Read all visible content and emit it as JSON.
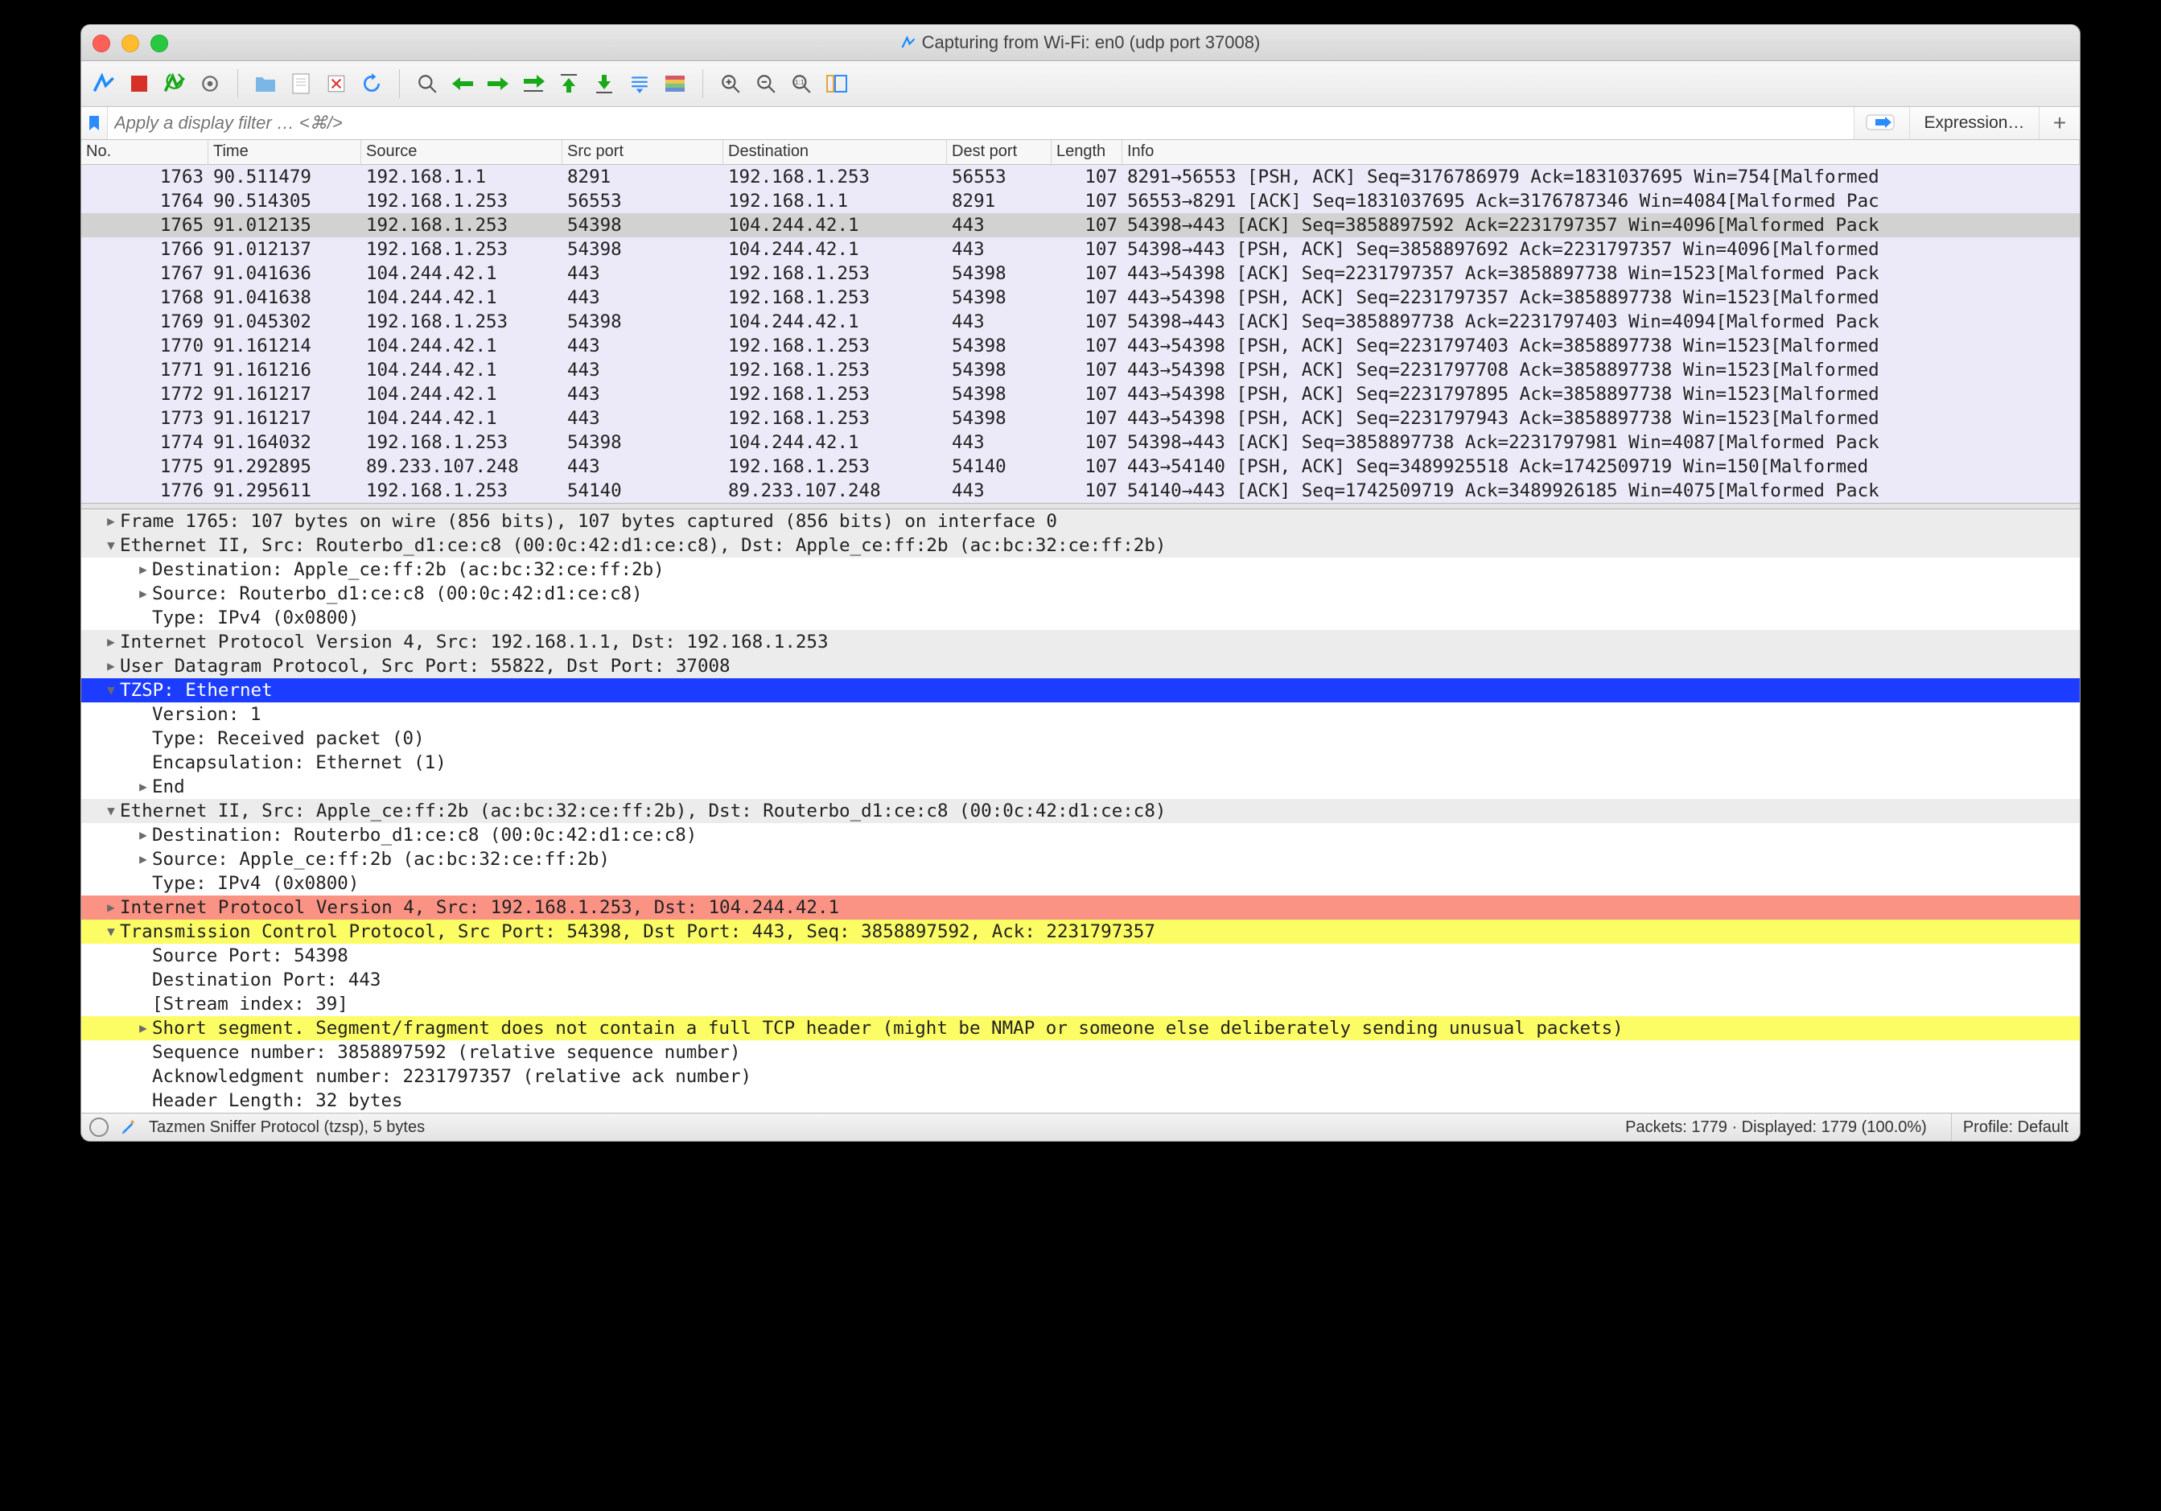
{
  "title": "Capturing from Wi-Fi: en0 (udp port 37008)",
  "filter": {
    "placeholder": "Apply a display filter … <⌘/>",
    "expression": "Expression…"
  },
  "columns": {
    "no": "No.",
    "time": "Time",
    "src": "Source",
    "sport": "Src port",
    "dst": "Destination",
    "dport": "Dest port",
    "len": "Length",
    "info": "Info"
  },
  "packets": [
    {
      "no": "1763",
      "time": "90.511479",
      "src": "192.168.1.1",
      "sport": "8291",
      "dst": "192.168.1.253",
      "dport": "56553",
      "len": "107",
      "info": "8291→56553 [PSH, ACK] Seq=3176786979 Ack=1831037695 Win=754[Malformed",
      "cls": "purple"
    },
    {
      "no": "1764",
      "time": "90.514305",
      "src": "192.168.1.253",
      "sport": "56553",
      "dst": "192.168.1.1",
      "dport": "8291",
      "len": "107",
      "info": "56553→8291 [ACK] Seq=1831037695 Ack=3176787346 Win=4084[Malformed Pac",
      "cls": "purple"
    },
    {
      "no": "1765",
      "time": "91.012135",
      "src": "192.168.1.253",
      "sport": "54398",
      "dst": "104.244.42.1",
      "dport": "443",
      "len": "107",
      "info": "54398→443 [ACK] Seq=3858897592 Ack=2231797357 Win=4096[Malformed Pack",
      "cls": "selected"
    },
    {
      "no": "1766",
      "time": "91.012137",
      "src": "192.168.1.253",
      "sport": "54398",
      "dst": "104.244.42.1",
      "dport": "443",
      "len": "107",
      "info": "54398→443 [PSH, ACK] Seq=3858897692 Ack=2231797357 Win=4096[Malformed",
      "cls": "purple"
    },
    {
      "no": "1767",
      "time": "91.041636",
      "src": "104.244.42.1",
      "sport": "443",
      "dst": "192.168.1.253",
      "dport": "54398",
      "len": "107",
      "info": "443→54398 [ACK] Seq=2231797357 Ack=3858897738 Win=1523[Malformed Pack",
      "cls": "purple"
    },
    {
      "no": "1768",
      "time": "91.041638",
      "src": "104.244.42.1",
      "sport": "443",
      "dst": "192.168.1.253",
      "dport": "54398",
      "len": "107",
      "info": "443→54398 [PSH, ACK] Seq=2231797357 Ack=3858897738 Win=1523[Malformed",
      "cls": "purple"
    },
    {
      "no": "1769",
      "time": "91.045302",
      "src": "192.168.1.253",
      "sport": "54398",
      "dst": "104.244.42.1",
      "dport": "443",
      "len": "107",
      "info": "54398→443 [ACK] Seq=3858897738 Ack=2231797403 Win=4094[Malformed Pack",
      "cls": "purple"
    },
    {
      "no": "1770",
      "time": "91.161214",
      "src": "104.244.42.1",
      "sport": "443",
      "dst": "192.168.1.253",
      "dport": "54398",
      "len": "107",
      "info": "443→54398 [PSH, ACK] Seq=2231797403 Ack=3858897738 Win=1523[Malformed",
      "cls": "purple"
    },
    {
      "no": "1771",
      "time": "91.161216",
      "src": "104.244.42.1",
      "sport": "443",
      "dst": "192.168.1.253",
      "dport": "54398",
      "len": "107",
      "info": "443→54398 [PSH, ACK] Seq=2231797708 Ack=3858897738 Win=1523[Malformed",
      "cls": "purple"
    },
    {
      "no": "1772",
      "time": "91.161217",
      "src": "104.244.42.1",
      "sport": "443",
      "dst": "192.168.1.253",
      "dport": "54398",
      "len": "107",
      "info": "443→54398 [PSH, ACK] Seq=2231797895 Ack=3858897738 Win=1523[Malformed",
      "cls": "purple"
    },
    {
      "no": "1773",
      "time": "91.161217",
      "src": "104.244.42.1",
      "sport": "443",
      "dst": "192.168.1.253",
      "dport": "54398",
      "len": "107",
      "info": "443→54398 [PSH, ACK] Seq=2231797943 Ack=3858897738 Win=1523[Malformed",
      "cls": "purple"
    },
    {
      "no": "1774",
      "time": "91.164032",
      "src": "192.168.1.253",
      "sport": "54398",
      "dst": "104.244.42.1",
      "dport": "443",
      "len": "107",
      "info": "54398→443 [ACK] Seq=3858897738 Ack=2231797981 Win=4087[Malformed Pack",
      "cls": "purple"
    },
    {
      "no": "1775",
      "time": "91.292895",
      "src": "89.233.107.248",
      "sport": "443",
      "dst": "192.168.1.253",
      "dport": "54140",
      "len": "107",
      "info": "443→54140 [PSH, ACK] Seq=3489925518 Ack=1742509719 Win=150[Malformed",
      "cls": "purple"
    },
    {
      "no": "1776",
      "time": "91.295611",
      "src": "192.168.1.253",
      "sport": "54140",
      "dst": "89.233.107.248",
      "dport": "443",
      "len": "107",
      "info": "54140→443 [ACK] Seq=1742509719 Ack=3489926185 Win=4075[Malformed Pack",
      "cls": "purple"
    }
  ],
  "tree": [
    {
      "ind": 0,
      "tri": "closed",
      "txt": "Frame 1765: 107 bytes on wire (856 bits), 107 bytes captured (856 bits) on interface 0",
      "bg": "grey"
    },
    {
      "ind": 0,
      "tri": "open",
      "txt": "Ethernet II, Src: Routerbo_d1:ce:c8 (00:0c:42:d1:ce:c8), Dst: Apple_ce:ff:2b (ac:bc:32:ce:ff:2b)",
      "bg": "grey"
    },
    {
      "ind": 1,
      "tri": "closed",
      "txt": "Destination: Apple_ce:ff:2b (ac:bc:32:ce:ff:2b)"
    },
    {
      "ind": 1,
      "tri": "closed",
      "txt": "Source: Routerbo_d1:ce:c8 (00:0c:42:d1:ce:c8)"
    },
    {
      "ind": 1,
      "tri": "",
      "txt": "Type: IPv4 (0x0800)"
    },
    {
      "ind": 0,
      "tri": "closed",
      "txt": "Internet Protocol Version 4, Src: 192.168.1.1, Dst: 192.168.1.253",
      "bg": "grey"
    },
    {
      "ind": 0,
      "tri": "closed",
      "txt": "User Datagram Protocol, Src Port: 55822, Dst Port: 37008",
      "bg": "grey"
    },
    {
      "ind": 0,
      "tri": "open",
      "txt": "TZSP: Ethernet",
      "bg": "blue"
    },
    {
      "ind": 1,
      "tri": "",
      "txt": "Version: 1"
    },
    {
      "ind": 1,
      "tri": "",
      "txt": "Type: Received packet (0)"
    },
    {
      "ind": 1,
      "tri": "",
      "txt": "Encapsulation: Ethernet (1)"
    },
    {
      "ind": 1,
      "tri": "closed",
      "txt": "End"
    },
    {
      "ind": 0,
      "tri": "open",
      "txt": "Ethernet II, Src: Apple_ce:ff:2b (ac:bc:32:ce:ff:2b), Dst: Routerbo_d1:ce:c8 (00:0c:42:d1:ce:c8)",
      "bg": "grey"
    },
    {
      "ind": 1,
      "tri": "closed",
      "txt": "Destination: Routerbo_d1:ce:c8 (00:0c:42:d1:ce:c8)"
    },
    {
      "ind": 1,
      "tri": "closed",
      "txt": "Source: Apple_ce:ff:2b (ac:bc:32:ce:ff:2b)"
    },
    {
      "ind": 1,
      "tri": "",
      "txt": "Type: IPv4 (0x0800)"
    },
    {
      "ind": 0,
      "tri": "closed",
      "txt": "Internet Protocol Version 4, Src: 192.168.1.253, Dst: 104.244.42.1",
      "bg": "red"
    },
    {
      "ind": 0,
      "tri": "open",
      "txt": "Transmission Control Protocol, Src Port: 54398, Dst Port: 443, Seq: 3858897592, Ack: 2231797357",
      "bg": "yellow"
    },
    {
      "ind": 1,
      "tri": "",
      "txt": "Source Port: 54398"
    },
    {
      "ind": 1,
      "tri": "",
      "txt": "Destination Port: 443"
    },
    {
      "ind": 1,
      "tri": "",
      "txt": "[Stream index: 39]"
    },
    {
      "ind": 1,
      "tri": "closed",
      "txt": "Short segment. Segment/fragment does not contain a full TCP header (might be NMAP or someone else deliberately sending unusual packets)",
      "bg": "yellow"
    },
    {
      "ind": 1,
      "tri": "",
      "txt": "Sequence number: 3858897592    (relative sequence number)"
    },
    {
      "ind": 1,
      "tri": "",
      "txt": "Acknowledgment number: 2231797357    (relative ack number)"
    },
    {
      "ind": 1,
      "tri": "",
      "txt": "Header Length: 32 bytes"
    }
  ],
  "status": {
    "proto": "Tazmen Sniffer Protocol (tzsp), 5 bytes",
    "packets": "Packets: 1779 · Displayed: 1779 (100.0%)",
    "profile": "Profile: Default"
  }
}
